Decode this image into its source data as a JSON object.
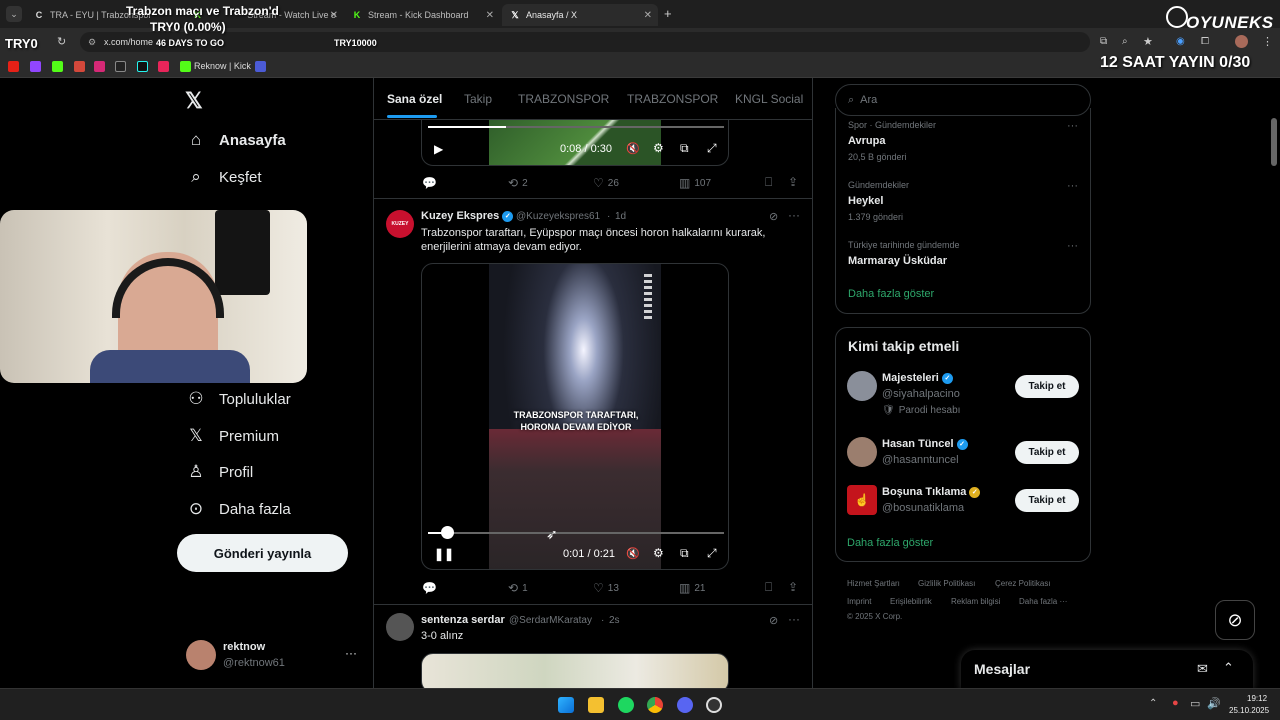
{
  "browser": {
    "tabs": [
      {
        "label": "TRA - EYU | Trabzonspor"
      },
      {
        "label": "Stream - Watch Live o"
      },
      {
        "label": "Stream - Kick Dashboard"
      },
      {
        "label": "Anasayfa / X"
      }
    ],
    "address": "x.com/home",
    "bookmark_label": "Reknow | Kick"
  },
  "overlay": {
    "top_title": "Trabzon maçı ve Trabzon'd",
    "top_amount": "TRY0 (0.00%)",
    "try_left": "TRY0",
    "days_to_go": "46 DAYS TO GO",
    "try_goal": "TRY10000",
    "brand": "OYUNEKS",
    "stream_hours": "12 SAAT YAYIN 0/30"
  },
  "sidebar": {
    "items": [
      {
        "label": "Anasayfa",
        "icon": "home-icon"
      },
      {
        "label": "Keşfet",
        "icon": "search-icon"
      },
      {
        "label": "Topluluklar",
        "icon": "communities-icon"
      },
      {
        "label": "Premium",
        "icon": "x-logo-icon"
      },
      {
        "label": "Profil",
        "icon": "profile-icon"
      },
      {
        "label": "Daha fazla",
        "icon": "more-circle-icon"
      }
    ],
    "post_button": "Gönderi yayınla",
    "user_name": "rektnow",
    "user_handle": "@rektnow61"
  },
  "feed": {
    "tabs": [
      "Sana özel",
      "Takip",
      "TRABZONSPOR",
      "TRABZONSPOR",
      "KNGL Social"
    ],
    "post0": {
      "time": "0:08 / 0:30",
      "replies": "",
      "reposts": "2",
      "likes": "26",
      "views": "107"
    },
    "post1": {
      "name": "Kuzey Ekspres",
      "handle": "@Kuzeyekspres61",
      "time": "1d",
      "text": "Trabzonspor taraftarı, Eyüpspor maçı öncesi horon halkalarını kurarak, enerjilerini atmaya devam ediyor.",
      "video_caption": "TRABZONSPOR TARAFTARI, HORONA DEVAM EDİYOR",
      "video_time": "0:01 / 0:21",
      "reposts": "1",
      "likes": "13",
      "views": "21"
    },
    "post2": {
      "name": "sentenza serdar",
      "handle": "@SerdarMKaratay",
      "time": "2s",
      "text": "3-0 alınz"
    }
  },
  "right": {
    "search_placeholder": "Ara",
    "trends": [
      {
        "category": "Spor · Gündemdekiler",
        "name": "Avrupa",
        "count": "20,5 B gönderi"
      },
      {
        "category": "Gündemdekiler",
        "name": "Heykel",
        "count": "1.379 gönderi"
      },
      {
        "category": "Türkiye tarihinde gündemde",
        "name": "Marmaray Üsküdar",
        "count": ""
      }
    ],
    "show_more": "Daha fazla göster",
    "who_to_follow_title": "Kimi takip etmeli",
    "follow": [
      {
        "name": "Majesteleri",
        "handle": "@siyahalpacino",
        "note": "Parodi hesabı",
        "button": "Takip et"
      },
      {
        "name": "Hasan Tüncel",
        "handle": "@hasanntuncel",
        "note": "",
        "button": "Takip et"
      },
      {
        "name": "Boşuna Tıklama",
        "handle": "@bosunatiklama",
        "note": "",
        "button": "Takip et"
      }
    ],
    "show_more2": "Daha fazla göster",
    "footer": {
      "links1": [
        "Hizmet Şartları",
        "Gizlilik Politikası",
        "Çerez Politikası"
      ],
      "links2": [
        "Imprint",
        "Erişilebilirlik",
        "Reklam bilgisi",
        "Daha fazla ···"
      ],
      "copyright": "© 2025 X Corp."
    },
    "messages": "Mesajlar"
  },
  "taskbar": {
    "time": "19:12",
    "date": "25.10.2025"
  }
}
